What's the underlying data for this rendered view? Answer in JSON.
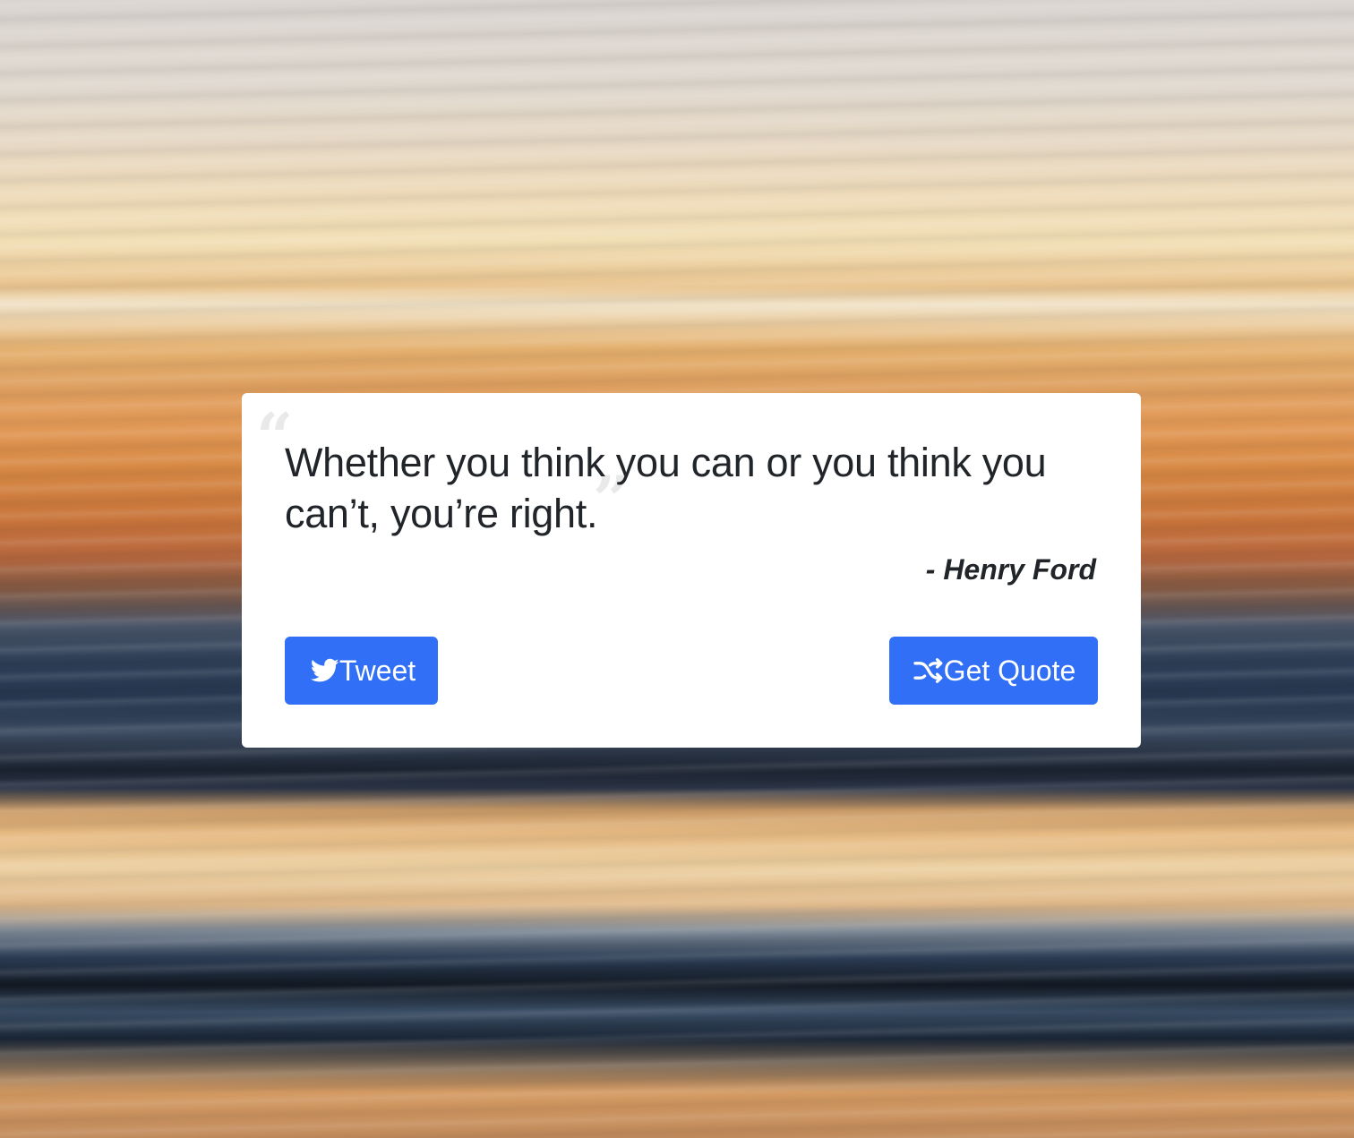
{
  "quote": {
    "text": "Whether you think you can or you think you can’t, you’re right.",
    "author": "- Henry Ford",
    "open_mark": "“",
    "close_mark": "”"
  },
  "buttons": {
    "tweet_label": "Tweet",
    "tweet_icon": "twitter-bird-icon",
    "get_quote_label": "Get Quote",
    "get_quote_icon": "shuffle-icon"
  },
  "colors": {
    "button_bg": "#316ff6",
    "button_text": "#ffffff",
    "quote_text": "#212529",
    "quote_mark": "#e9e9e9",
    "card_bg": "#ffffff"
  }
}
